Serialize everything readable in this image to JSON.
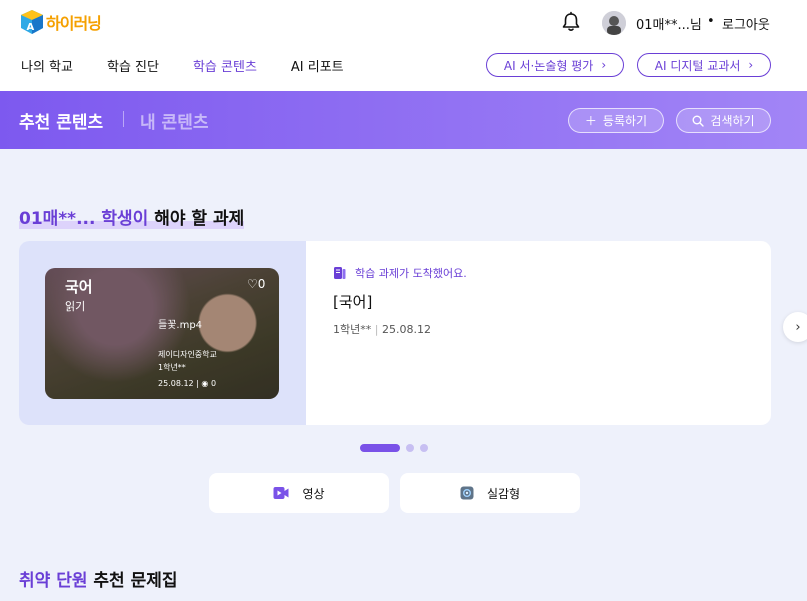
{
  "header": {
    "logo_text": "하이러닝",
    "user_name": "01매**...님",
    "separator": "•",
    "logout": "로그아웃"
  },
  "nav": {
    "items": [
      {
        "label": "나의 학교"
      },
      {
        "label": "학습 진단"
      },
      {
        "label": "학습 콘텐츠",
        "active": true
      },
      {
        "label": "AI 리포트"
      }
    ],
    "ai_essay": "AI 서·논술형 평가",
    "ai_textbook": "AI 디지털 교과서"
  },
  "band": {
    "title": "추천 콘텐츠",
    "sub": "내 콘텐츠",
    "register": "등록하기",
    "search": "검색하기"
  },
  "assignment": {
    "title_highlight": "01매**... 학생이",
    "title_rest": "해야 할 과제",
    "thumb": {
      "subject": "국어",
      "subtopic": "읽기",
      "likes": "0",
      "file": "들꽃.mp4",
      "school": "제이디자인중학교",
      "grade": "1학년**",
      "date": "25.08.12",
      "views": "0"
    },
    "notice": "학습 과제가 도착했어요.",
    "task_title": "[국어]",
    "task_grade": "1학년**",
    "task_date": "25.08.12"
  },
  "carousel": {
    "total": 3,
    "active": 0
  },
  "types": {
    "video": "영상",
    "immersive": "실감형"
  },
  "weak": {
    "title_highlight": "취약 단원",
    "title_rest": "추천 문제집"
  },
  "colors": {
    "accent": "#6a3fd6",
    "band_start": "#7d59ef",
    "band_end": "#a285f6"
  }
}
